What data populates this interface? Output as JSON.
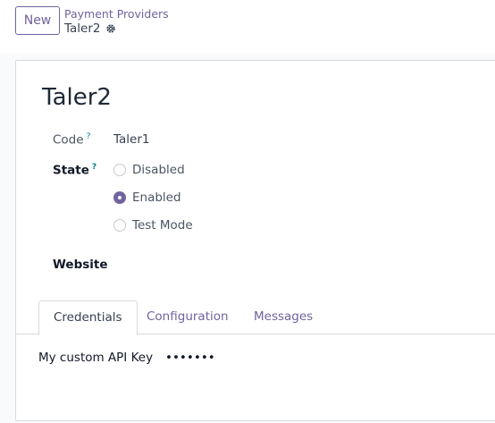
{
  "toolbar": {
    "new_label": "New"
  },
  "breadcrumb": {
    "parent": "Payment Providers",
    "current": "Taler2"
  },
  "record": {
    "title": "Taler2",
    "code_label": "Code",
    "code_help": "?",
    "code_value": "Taler1",
    "state_label": "State",
    "state_help": "?",
    "state_options": [
      {
        "label": "Disabled",
        "checked": false
      },
      {
        "label": "Enabled",
        "checked": true
      },
      {
        "label": "Test Mode",
        "checked": false
      }
    ],
    "website_label": "Website"
  },
  "tabs": [
    {
      "label": "Credentials",
      "active": true
    },
    {
      "label": "Configuration",
      "active": false
    },
    {
      "label": "Messages",
      "active": false
    }
  ],
  "credentials": {
    "api_key_label": "My custom API Key",
    "api_key_value": "•••••••"
  },
  "colors": {
    "accent": "#71639e",
    "help": "#017e84"
  }
}
